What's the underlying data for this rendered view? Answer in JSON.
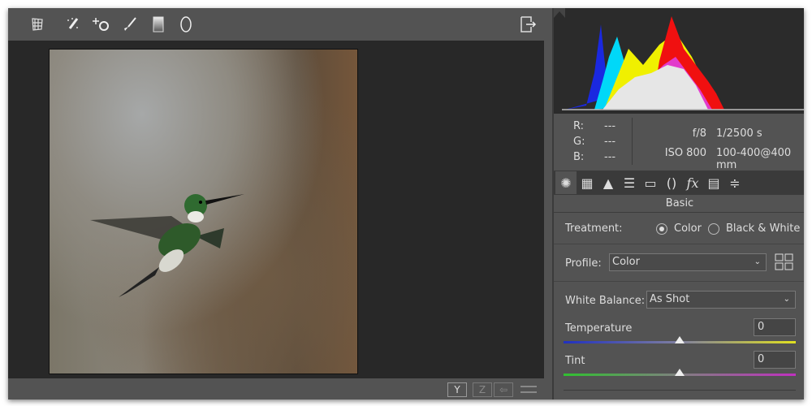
{
  "toolbar": {
    "tools": [
      "transform-tool",
      "spot-removal-tool",
      "red-eye-tool",
      "adjustment-brush-tool",
      "graduated-filter-tool",
      "radial-filter-tool"
    ],
    "export_icon": "open-object-icon"
  },
  "info": {
    "r_label": "R:",
    "g_label": "G:",
    "b_label": "B:",
    "r": "---",
    "g": "---",
    "b": "---",
    "aperture": "f/8",
    "shutter": "1/2500 s",
    "iso": "ISO 800",
    "lens": "100-400@400 mm"
  },
  "panel": {
    "section_title": "Basic",
    "treatment_label": "Treatment:",
    "treatment_color": "Color",
    "treatment_bw": "Black & White",
    "treatment_selected": "Color",
    "profile_label": "Profile:",
    "profile_value": "Color",
    "wb_label": "White Balance:",
    "wb_value": "As Shot",
    "temperature_label": "Temperature",
    "temperature_value": "0",
    "temperature_pos": 0.5,
    "tint_label": "Tint",
    "tint_value": "0",
    "tint_pos": 0.5
  },
  "bottom": {
    "btn1": "Y",
    "btn2": "Z",
    "btn3": "⇦"
  },
  "colors": {
    "panel": "#535353",
    "stage": "#282828",
    "histogram": "#2b2b2b"
  }
}
